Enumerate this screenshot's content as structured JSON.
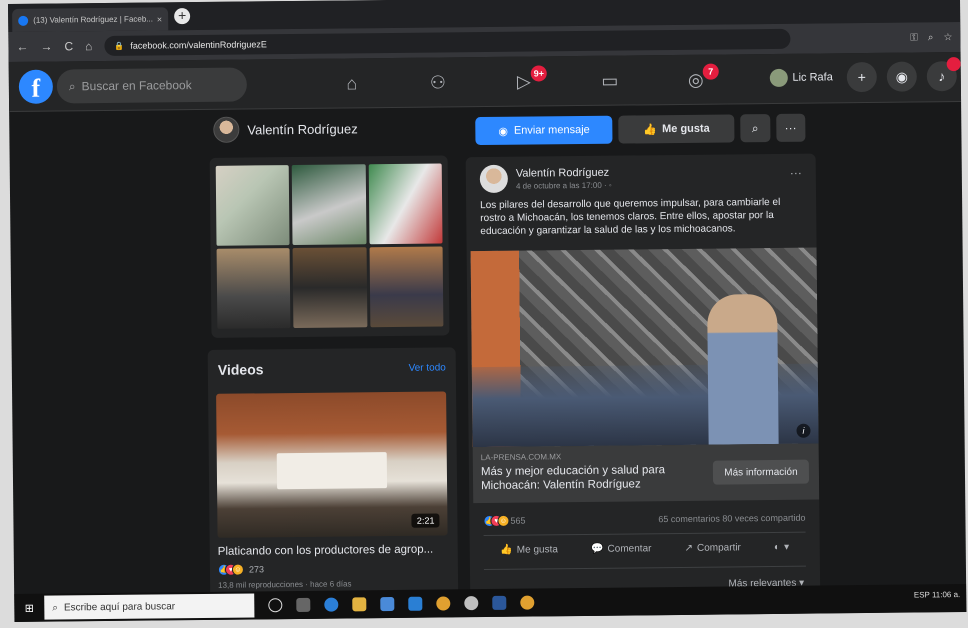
{
  "browser": {
    "tab_title": "(13) Valentín Rodríguez | Faceb...",
    "tab_close": "×",
    "new_tab": "+",
    "back": "←",
    "forward": "→",
    "reload": "C",
    "home": "⌂",
    "url": "facebook.com/valentinRodriguezE"
  },
  "fb_header": {
    "logo": "f",
    "search_placeholder": "Buscar en Facebook",
    "nav": [
      {
        "icon": "home-icon",
        "glyph": "⌂",
        "badge": ""
      },
      {
        "icon": "friends-icon",
        "glyph": "⚇",
        "badge": ""
      },
      {
        "icon": "watch-icon",
        "glyph": "▷",
        "badge": "9+"
      },
      {
        "icon": "marketplace-icon",
        "glyph": "▭",
        "badge": ""
      },
      {
        "icon": "groups-icon",
        "glyph": "◎",
        "badge": "7"
      }
    ],
    "profile_name": "Lic Rafa",
    "create": "+",
    "messenger": "◉",
    "notifications": "🔔"
  },
  "page": {
    "name": "Valentín Rodríguez"
  },
  "videos": {
    "title": "Videos",
    "see_all": "Ver todo",
    "duration": "2:21",
    "caption": "Platicando con los productores de agrop...",
    "reaction_count": "273",
    "meta": "13,8 mil reproducciones · hace 6 días"
  },
  "actions": {
    "message": "Enviar mensaje",
    "like": "Me gusta",
    "search": "⌕",
    "more": "···"
  },
  "post": {
    "author": "Valentín Rodríguez",
    "date": "4 de octubre a las 17:00 · ◦",
    "more": "···",
    "text": "Los pilares del desarrollo que queremos impulsar, para cambiarle el rostro a Michoacán, los tenemos claros. Entre ellos, apostar por la educación y garantizar la salud de las y los michoacanos.",
    "link_source": "LA-PRENSA.COM.MX",
    "link_title": "Más y mejor educación y salud para Michoacán: Valentín Rodríguez",
    "link_button": "Más información",
    "reaction_count": "565",
    "stats": "65 comentarios  80 veces compartido",
    "like": "Me gusta",
    "comment": "Comentar",
    "share": "Compartir",
    "sort": "Más relevantes ▾"
  },
  "taskbar": {
    "search_placeholder": "Escribe aquí para buscar",
    "tray": "ESP  11:06 a."
  },
  "colors": {
    "background": "#18191a",
    "card": "#242526",
    "accent": "#2d88ff",
    "badge": "#e41e3f"
  }
}
